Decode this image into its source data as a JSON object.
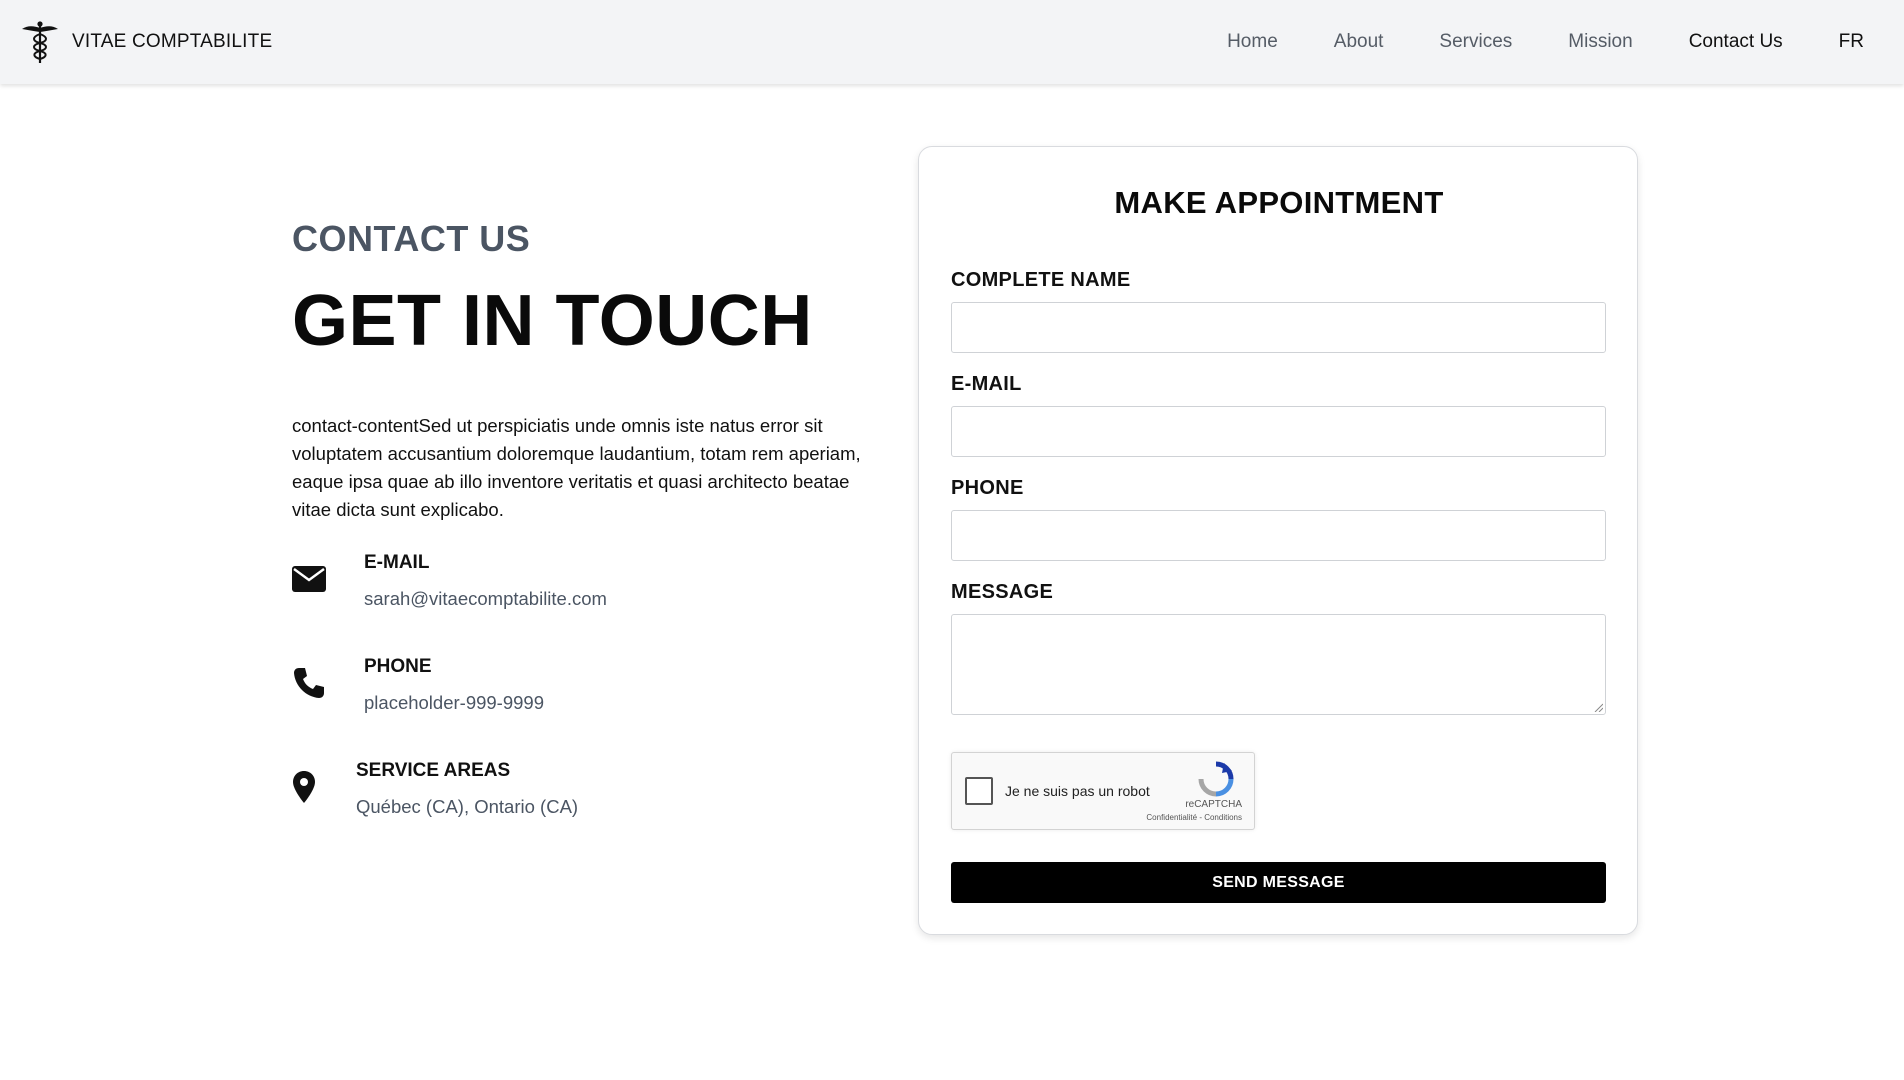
{
  "header": {
    "brand_name": "VITAE COMPTABILITE",
    "logo_icon": "caduceus-icon",
    "nav": [
      {
        "label": "Home",
        "active": false
      },
      {
        "label": "About",
        "active": false
      },
      {
        "label": "Services",
        "active": false
      },
      {
        "label": "Mission",
        "active": false
      },
      {
        "label": "Contact Us",
        "active": true
      },
      {
        "label": "FR",
        "active": false
      }
    ]
  },
  "contact": {
    "eyebrow": "CONTACT US",
    "headline": "GET IN TOUCH",
    "intro": "contact-contentSed ut perspiciatis unde omnis iste natus error sit voluptatem accusantium doloremque laudantium, totam rem aperiam, eaque ipsa quae ab illo inventore veritatis et quasi architecto beatae vitae dicta sunt explicabo.",
    "items": [
      {
        "icon": "envelope-icon",
        "title": "E-MAIL",
        "value": "sarah@vitaecomptabilite.com"
      },
      {
        "icon": "phone-icon",
        "title": "PHONE",
        "value": "placeholder-999-9999"
      },
      {
        "icon": "map-pin-icon",
        "title": "SERVICE AREAS",
        "value": "Québec (CA), Ontario (CA)"
      }
    ]
  },
  "form": {
    "title": "MAKE APPOINTMENT",
    "fields": {
      "name_label": "COMPLETE NAME",
      "name_value": "",
      "email_label": "E-MAIL",
      "email_value": "",
      "phone_label": "PHONE",
      "phone_value": "",
      "message_label": "MESSAGE",
      "message_value": ""
    },
    "captcha": {
      "label": "Je ne suis pas un robot",
      "brand": "reCAPTCHA",
      "links": "Confidentialité - Conditions",
      "checked": false
    },
    "submit_label": "SEND MESSAGE"
  },
  "colors": {
    "header_bg": "#f3f4f6",
    "accent": "#000000",
    "muted_text": "#4b5563"
  }
}
